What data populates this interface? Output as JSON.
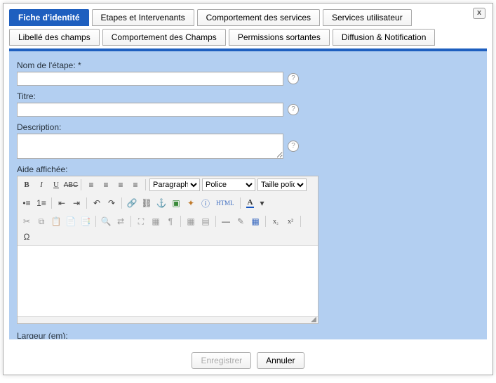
{
  "close_label": "x",
  "tabs_row1": [
    {
      "label": "Fiche d'identité",
      "active": true,
      "name": "tab-identite"
    },
    {
      "label": "Etapes et Intervenants",
      "active": false,
      "name": "tab-etapes"
    },
    {
      "label": "Comportement des services",
      "active": false,
      "name": "tab-comportement-services"
    },
    {
      "label": "Services utilisateur",
      "active": false,
      "name": "tab-services-utilisateur"
    }
  ],
  "tabs_row2": [
    {
      "label": "Libellé des champs",
      "name": "tab-libelle-champs"
    },
    {
      "label": "Comportement des Champs",
      "name": "tab-comportement-champs"
    },
    {
      "label": "Permissions sortantes",
      "name": "tab-permissions-sortantes"
    },
    {
      "label": "Diffusion & Notification",
      "name": "tab-diffusion-notification"
    }
  ],
  "fields": {
    "nom": {
      "label": "Nom de l'étape: *",
      "value": ""
    },
    "titre": {
      "label": "Titre:",
      "value": ""
    },
    "description": {
      "label": "Description:",
      "value": ""
    },
    "aide": {
      "label": "Aide affichée:"
    },
    "largeur": {
      "label": "Largeur (em):",
      "value": ""
    }
  },
  "editor": {
    "para": "Paragraphe",
    "font": "Police",
    "size": "Taille police",
    "html": "HTML"
  },
  "buttons": {
    "save": "Enregistrer",
    "cancel": "Annuler"
  }
}
